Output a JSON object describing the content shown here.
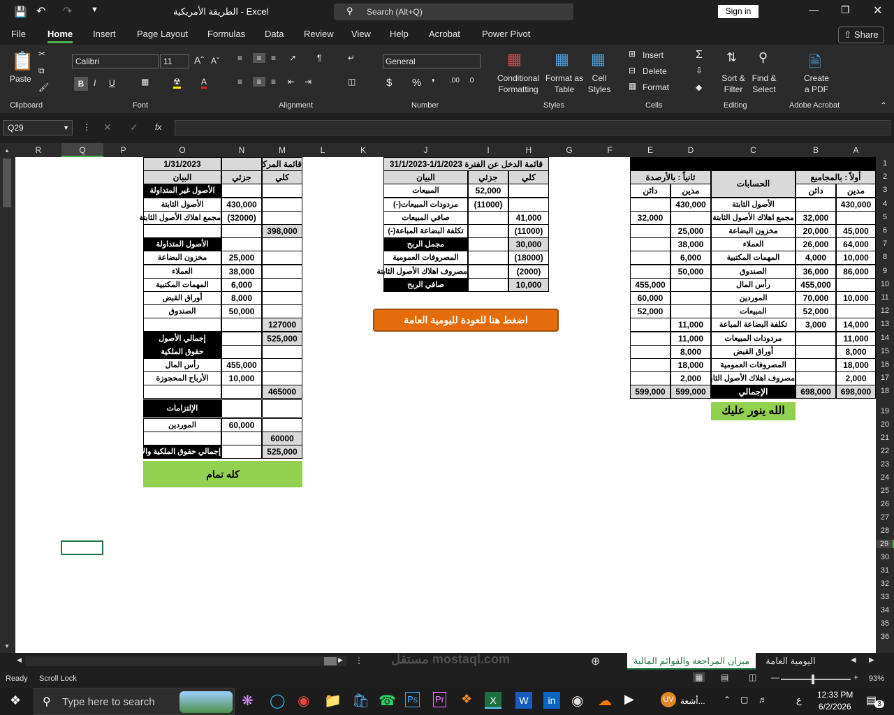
{
  "window": {
    "title": "الطريقة الأمريكية - Excel",
    "search": "Search (Alt+Q)",
    "sign_in": "Sign in"
  },
  "menu": [
    "File",
    "Home",
    "Insert",
    "Page Layout",
    "Formulas",
    "Data",
    "Review",
    "View",
    "Help",
    "Acrobat",
    "Power Pivot"
  ],
  "share": "Share",
  "ribbon": {
    "paste": "Paste",
    "font_name": "Calibri",
    "font_size": "11",
    "number_format": "General",
    "cond_format": "Conditional Formatting",
    "format_table": "Format as Table",
    "cell_styles": "Cell Styles",
    "insert": "Insert",
    "delete": "Delete",
    "format": "Format",
    "sort_filter": "Sort & Filter",
    "find_select": "Find & Select",
    "create_pdf": "Create a PDF",
    "groups": [
      "Clipboard",
      "Font",
      "Alignment",
      "Number",
      "Styles",
      "Cells",
      "Editing",
      "Adobe Acrobat"
    ]
  },
  "namebox": "Q29",
  "fx": "fx",
  "columns": [
    "R",
    "Q",
    "P",
    "O",
    "N",
    "M",
    "L",
    "K",
    "J",
    "I",
    "H",
    "G",
    "F",
    "E",
    "D",
    "C",
    "B",
    "A"
  ],
  "rows": [
    "1",
    "2",
    "3",
    "4",
    "5",
    "6",
    "7",
    "8",
    "9",
    "10",
    "11",
    "12",
    "13",
    "14",
    "15",
    "16",
    "17",
    "18",
    "19",
    "20",
    "21",
    "22",
    "23",
    "24",
    "25",
    "26",
    "27",
    "28",
    "29",
    "30",
    "31",
    "32",
    "33",
    "34",
    "35",
    "36"
  ],
  "trial": {
    "h1": "أولاً : بالمجاميع",
    "h2": "ثانياً : بالأرصدة",
    "accounts": "الحسابات",
    "debit": "مدين",
    "credit": "دائن",
    "rows": [
      [
        "430,000",
        "",
        "الأصول الثابتة",
        "430,000",
        ""
      ],
      [
        "",
        "32,000",
        "مجمع اهلاك الأصول الثابتة",
        "",
        "32,000"
      ],
      [
        "45,000",
        "20,000",
        "مخزون البضاعة",
        "25,000",
        ""
      ],
      [
        "64,000",
        "26,000",
        "العملاء",
        "38,000",
        ""
      ],
      [
        "10,000",
        "4,000",
        "المهمات المكتبية",
        "6,000",
        ""
      ],
      [
        "86,000",
        "36,000",
        "الصندوق",
        "50,000",
        ""
      ],
      [
        "",
        "455,000",
        "رأس المال",
        "",
        "455,000"
      ],
      [
        "10,000",
        "70,000",
        "الموردين",
        "",
        "60,000"
      ],
      [
        "",
        "52,000",
        "المبيعات",
        "",
        "52,000"
      ],
      [
        "14,000",
        "3,000",
        "تكلفة البضاعة المباعة",
        "11,000",
        ""
      ],
      [
        "11,000",
        "",
        "مردودات المبيعات",
        "11,000",
        ""
      ],
      [
        "8,000",
        "",
        "أوراق القبض",
        "8,000",
        ""
      ],
      [
        "18,000",
        "",
        "المصروفات العمومية",
        "18,000",
        ""
      ],
      [
        "2,000",
        "",
        "مصروف اهلاك الأصول الثابتة",
        "2,000",
        ""
      ]
    ],
    "total_label": "الإجمالي",
    "totals": [
      "698,000",
      "698,000",
      "599,000",
      "599,000"
    ],
    "note": "الله ينور عليك"
  },
  "income": {
    "title": "قائمة الدخل عن الفترة  1/1/2023-31/1/2023",
    "col_item": "البيان",
    "col_part": "جزئي",
    "col_total": "كلي",
    "rows": [
      [
        "المبيعات",
        "52,000",
        ""
      ],
      [
        "مردودات المبيعات(-)",
        "(11000)",
        ""
      ],
      [
        "صافي المبيعات",
        "",
        "41,000"
      ],
      [
        "تكلفة البضاعة المباعة(-)",
        "",
        "(11000)"
      ],
      [
        "مجمل الربح",
        "",
        "30,000"
      ],
      [
        "المصروفات العمومية",
        "",
        "(18000)"
      ],
      [
        "مصروف اهلاك الأصول الثابتة",
        "",
        "(2000)"
      ],
      [
        "صافي الربح",
        "",
        "10,000"
      ]
    ],
    "button": "اضغط هنا للعودة لليومية العامة"
  },
  "balance": {
    "title": "قائمة المركز المالي في",
    "date": "1/31/2023",
    "col_item": "البيان",
    "col_part": "جزئي",
    "col_total": "كلي",
    "rows": [
      [
        "الأصول غير المتداولة",
        "",
        ""
      ],
      [
        "الأصول الثابتة",
        "430,000",
        ""
      ],
      [
        "مجمع اهلاك الأصول الثابتة",
        "(32000)",
        ""
      ],
      [
        "",
        "",
        "398,000"
      ],
      [
        "الأصول المتداولة",
        "",
        ""
      ],
      [
        "مخزون البضاعة",
        "25,000",
        ""
      ],
      [
        "العملاء",
        "38,000",
        ""
      ],
      [
        "المهمات المكتبية",
        "6,000",
        ""
      ],
      [
        "أوراق القبض",
        "8,000",
        ""
      ],
      [
        "الصندوق",
        "50,000",
        ""
      ],
      [
        "",
        "",
        "127000"
      ],
      [
        "إجمالي الأصول",
        "",
        "525,000"
      ],
      [
        "حقوق الملكية",
        "",
        ""
      ],
      [
        "رأس المال",
        "455,000",
        ""
      ],
      [
        "الأرباح المحجوزة",
        "10,000",
        ""
      ],
      [
        "",
        "",
        "465000"
      ],
      [
        "الإلتزامات",
        "",
        ""
      ],
      [
        "الموردين",
        "60,000",
        ""
      ],
      [
        "",
        "",
        "60000"
      ],
      [
        "إجمالي حقوق الملكية والالتزامات",
        "",
        "525,000"
      ]
    ],
    "note": "كله تمام"
  },
  "tabs": [
    "اليومية العامة",
    "ميزان المراجعة والقوائم المالية"
  ],
  "status": {
    "ready": "Ready",
    "scroll": "Scroll Lock",
    "zoom": "93%"
  },
  "taskbar": {
    "search": "Type here to search",
    "time": "12:33 PM",
    "date": "6/2/2026",
    "lang": "ع",
    "notif": "3",
    "weather": "أشعة..."
  },
  "watermark": "مستقل mostaql.com"
}
